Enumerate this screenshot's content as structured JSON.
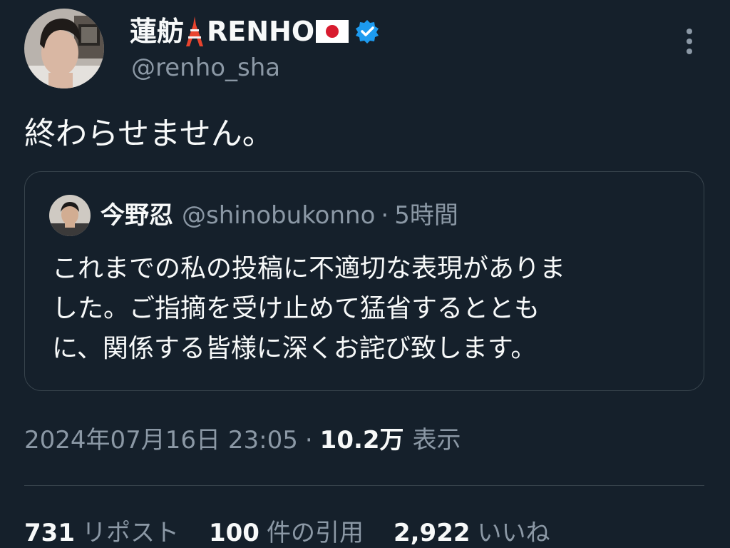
{
  "colors": {
    "background": "#15202b",
    "text_primary": "#f7f9f9",
    "text_secondary": "#8b98a5",
    "border": "#38444d",
    "verified": "#1d9bf0"
  },
  "author": {
    "name": "蓮舫",
    "name_suffix": "RENHO",
    "handle": "@renho_sha",
    "name_icons": [
      "tokyo-tower-icon",
      "japan-flag-icon",
      "verified-badge-icon"
    ]
  },
  "more_icon": "more-vertical-icon",
  "tweet": {
    "text": "終わらせません。"
  },
  "quote": {
    "name": "今野忍",
    "handle": "@shinobukonno",
    "separator": "·",
    "time": "5時間",
    "text_lines": [
      "これまでの私の投稿に不適切な表現がありま",
      "した。ご指摘を受け止めて猛省するととも",
      "に、関係する皆様に深くお詫び致します。"
    ]
  },
  "meta": {
    "datetime": "2024年07月16日 23:05",
    "separator": "·",
    "views_count": "10.2万",
    "views_label": "表示"
  },
  "stats": {
    "reposts": {
      "count": "731",
      "label": "リポスト"
    },
    "quotes": {
      "count": "100",
      "label": "件の引用"
    },
    "likes": {
      "count": "2,922",
      "label": "いいね"
    }
  }
}
